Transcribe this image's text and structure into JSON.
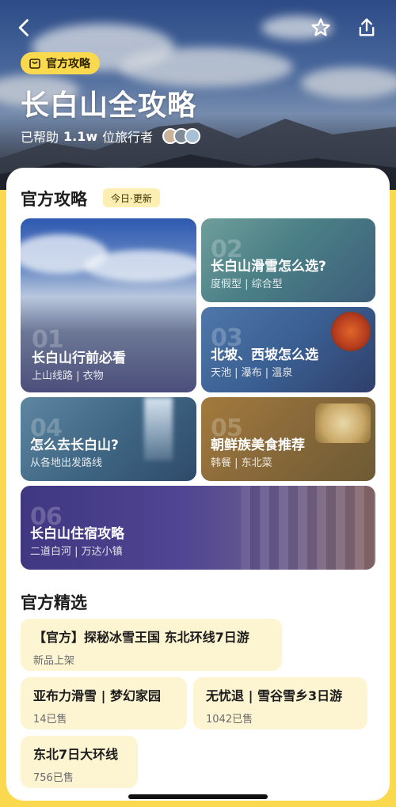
{
  "hero": {
    "badge": "官方攻略",
    "title": "长白山全攻略",
    "helped_prefix": "已帮助",
    "helped_count": "1.1w",
    "helped_suffix": "位旅行者",
    "icons": [
      "back-icon",
      "star-icon",
      "share-icon"
    ]
  },
  "guides": {
    "title": "官方攻略",
    "badge": "今日·更新",
    "items": [
      {
        "num": "01",
        "title": "长白山行前必看",
        "sub": "上山线路 | 衣物"
      },
      {
        "num": "02",
        "title": "长白山滑雪怎么选?",
        "sub": "度假型 | 综合型"
      },
      {
        "num": "03",
        "title": "北坡、西坡怎么选",
        "sub": "天池 | 瀑布 | 温泉"
      },
      {
        "num": "04",
        "title": "怎么去长白山?",
        "sub": "从各地出发路线"
      },
      {
        "num": "05",
        "title": "朝鲜族美食推荐",
        "sub": "韩餐 | 东北菜"
      },
      {
        "num": "06",
        "title": "长白山住宿攻略",
        "sub": "二道白河 | 万达小镇"
      }
    ]
  },
  "picks": {
    "title": "官方精选",
    "items": [
      {
        "title": "【官方】探秘冰雪王国 东北环线7日游",
        "sub": "新品上架"
      },
      {
        "title": "亚布力滑雪 | 梦幻家园",
        "sub": "14已售"
      },
      {
        "title": "无忧退 | 雪谷雪乡3日游",
        "sub": "1042已售"
      },
      {
        "title": "东北7日大环线",
        "sub": "756已售"
      }
    ]
  },
  "colors": {
    "accent": "#fbd94f",
    "chip": "#fdf4d2"
  }
}
